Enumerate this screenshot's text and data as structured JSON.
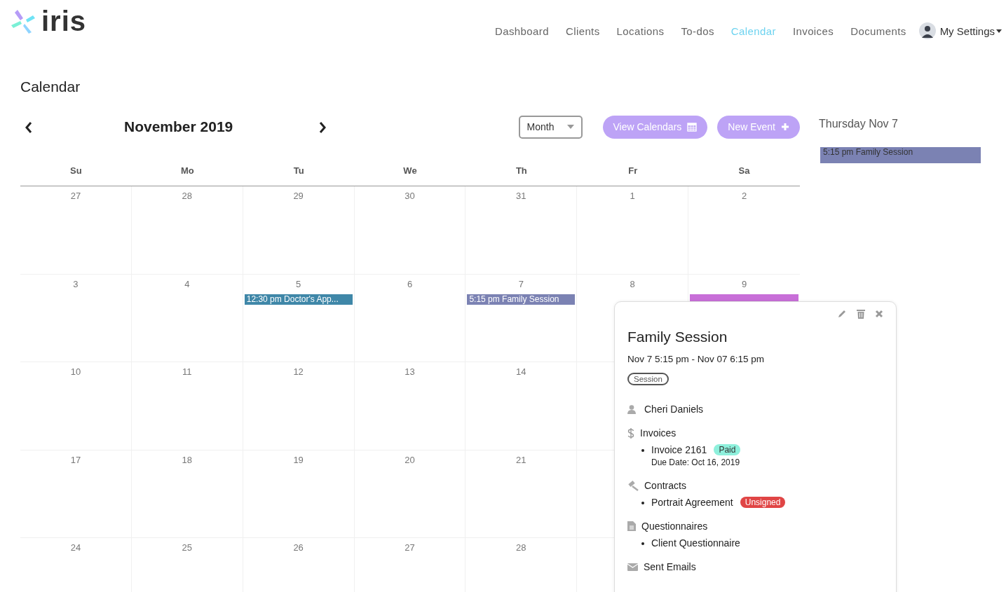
{
  "brand": {
    "name": "iris"
  },
  "nav": {
    "items": [
      {
        "label": "Dashboard",
        "selected": false
      },
      {
        "label": "Clients",
        "selected": false
      },
      {
        "label": "Locations",
        "selected": false
      },
      {
        "label": "To-dos",
        "selected": false
      },
      {
        "label": "Calendar",
        "selected": true
      },
      {
        "label": "Invoices",
        "selected": false
      },
      {
        "label": "Documents",
        "selected": false
      }
    ],
    "settings": "My Settings"
  },
  "page": {
    "title": "Calendar"
  },
  "toolbar": {
    "month_label": "November 2019",
    "view_select": "Month",
    "buttons": [
      "View Calendars",
      "New Event"
    ]
  },
  "calendar": {
    "weekdays": [
      "Su",
      "Mo",
      "Tu",
      "We",
      "Th",
      "Fr",
      "Sa"
    ],
    "weeks": [
      [
        {
          "day": "27"
        },
        {
          "day": "28"
        },
        {
          "day": "29"
        },
        {
          "day": "30"
        },
        {
          "day": "31"
        },
        {
          "day": "1"
        },
        {
          "day": "2"
        }
      ],
      [
        {
          "day": "3"
        },
        {
          "day": "4"
        },
        {
          "day": "5",
          "events": [
            {
              "title": "12:30 pm Doctor's App...",
              "color": "#3f87a8"
            }
          ]
        },
        {
          "day": "6"
        },
        {
          "day": "7",
          "events": [
            {
              "title": "5:15 pm Family Session",
              "color": "#7b82b3"
            }
          ]
        },
        {
          "day": "8"
        },
        {
          "day": "9",
          "events": [
            {
              "color": "#c86fd8"
            }
          ]
        }
      ],
      [
        {
          "day": "10"
        },
        {
          "day": "11"
        },
        {
          "day": "12"
        },
        {
          "day": "13"
        },
        {
          "day": "14"
        }
      ],
      [
        {
          "day": "17"
        },
        {
          "day": "18"
        },
        {
          "day": "19"
        },
        {
          "day": "20"
        },
        {
          "day": "21"
        }
      ],
      [
        {
          "day": "24"
        },
        {
          "day": "25"
        },
        {
          "day": "26"
        },
        {
          "day": "27"
        },
        {
          "day": "28"
        }
      ]
    ]
  },
  "day_panel": {
    "title": "Thursday Nov 7",
    "events": [
      {
        "title": "5:15 pm Family Session",
        "color": "#7b82b3"
      }
    ]
  },
  "popover": {
    "title": "Family Session",
    "time": "Nov 7 5:15 pm - Nov 07 6:15 pm",
    "tag": "Session",
    "client": "Cheri Daniels",
    "sections": [
      {
        "kind": "invoices",
        "heading": "Invoices",
        "items": [
          {
            "label": "Invoice 2161",
            "badge": "Paid",
            "color": "#8ef0dc",
            "sub": "Due Date: Oct 16, 2019"
          }
        ]
      },
      {
        "kind": "contracts",
        "heading": "Contracts",
        "items": [
          {
            "label": "Portrait Agreement",
            "badge": "Unsigned",
            "color": "#e04545"
          }
        ]
      },
      {
        "kind": "questionnaires",
        "heading": "Questionnaires",
        "items": [
          {
            "label": "Client Questionnaire"
          }
        ]
      },
      {
        "kind": "emails",
        "heading": "Sent Emails"
      }
    ]
  }
}
